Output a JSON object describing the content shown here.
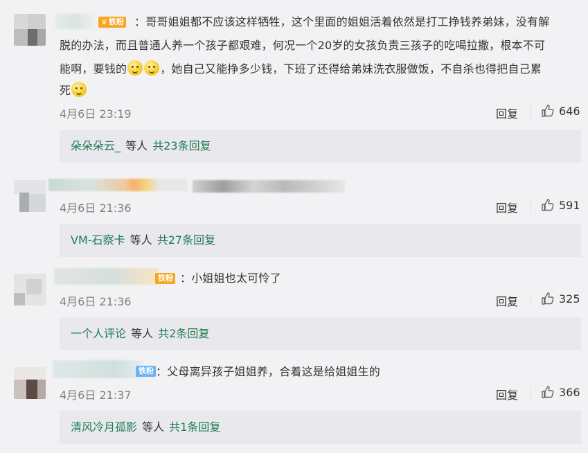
{
  "comments": [
    {
      "badge": "铁粉",
      "text_parts": {
        "line1": "：哥哥姐姐都不应该这样牺牲，这个里面的姐姐活着依然是打工挣钱养弟妹，没有解",
        "line2": "脱的办法，而且普通人养一个孩子都艰难，何况一个20岁的女孩负责三孩子的吃喝拉撒，根本不可",
        "line3a": "能啊，要钱的",
        "line3b": "，她自己又能挣多少钱，下班了还得给弟妹洗衣服做饭，不自杀也得把自己累",
        "line4": "死"
      },
      "time": "4月6日 23:19",
      "reply_label": "回复",
      "likes": "646",
      "replies": {
        "nick": "朵朵朵云_",
        "mid": "等人",
        "count": "共23条回复"
      }
    },
    {
      "text": "",
      "time": "4月6日 21:36",
      "reply_label": "回复",
      "likes": "591",
      "replies": {
        "nick": "VM-石察卡",
        "mid": "等人",
        "count": "共27条回复"
      }
    },
    {
      "badge": "铁粉",
      "text": "：小姐姐也太可怜了",
      "time": "4月6日 21:36",
      "reply_label": "回复",
      "likes": "325",
      "replies": {
        "nick": "一个人评论",
        "mid": "等人",
        "count": "共2条回复"
      }
    },
    {
      "badge": "铁粉",
      "text": "：父母离异孩子姐姐养，合着这是给姐姐生的",
      "time": "4月6日 21:37",
      "reply_label": "回复",
      "likes": "366",
      "replies": {
        "nick": "清风冷月孤影",
        "mid": "等人",
        "count": "共1条回复"
      }
    }
  ],
  "colors": {
    "background": "#f2f2f5",
    "reply_box": "#e9e9ed",
    "link_green": "#1e7b52",
    "badge_orange": "#f5a623",
    "badge_blue": "#6db3f2"
  },
  "icons": {
    "like": "thumbs-up-icon",
    "emoji": "smile-emoji-icon",
    "badge_crown": "crown-icon"
  }
}
